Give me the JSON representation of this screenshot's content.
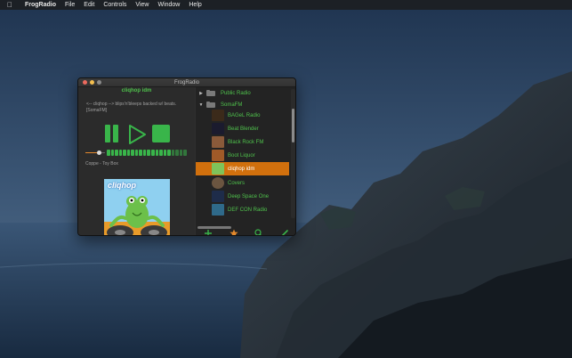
{
  "menubar": {
    "apple_icon": "apple-icon",
    "app_name": "FrogRadio",
    "items": [
      "File",
      "Edit",
      "Controls",
      "View",
      "Window",
      "Help"
    ]
  },
  "window": {
    "title": "FrogRadio"
  },
  "player": {
    "now_playing_title": "cliqhop idm",
    "description": "<-- cliqhop --> blips'n'bleeps backed w/ beats. [SomaFM]",
    "artist_track": "Coppe - Toy Box",
    "volume": 0.72,
    "cover_label": "cliqhop",
    "icons": {
      "pause": "pause-icon",
      "play": "play-icon",
      "stop": "stop-icon"
    },
    "meter_levels": [
      1,
      1,
      1,
      1,
      1,
      1,
      1,
      1,
      1,
      1,
      1,
      1,
      1,
      1,
      1,
      1,
      0.55,
      0.55,
      0.55,
      0.55
    ]
  },
  "stations": {
    "groups": [
      {
        "label": "Public Radio",
        "expanded": false
      },
      {
        "label": "SomaFM",
        "expanded": true
      }
    ],
    "items": [
      {
        "label": "BAGeL Radio",
        "selected": false
      },
      {
        "label": "Beat Blender",
        "selected": false
      },
      {
        "label": "Black Rock FM",
        "selected": false
      },
      {
        "label": "Boot Liquor",
        "selected": false
      },
      {
        "label": "cliqhop idm",
        "selected": true
      },
      {
        "label": "Covers",
        "selected": false
      },
      {
        "label": "Deep Space One",
        "selected": false
      },
      {
        "label": "DEF CON Radio",
        "selected": false
      }
    ]
  },
  "toolbar": {
    "add_icon": "plus-icon",
    "favorite_icon": "star-icon",
    "search_icon": "search-icon",
    "edit_icon": "pencil-icon"
  },
  "colors": {
    "accent_green": "#39b54a",
    "text_green": "#4fc24c",
    "selection_orange": "#d1700d",
    "star_orange": "#e3892c"
  }
}
